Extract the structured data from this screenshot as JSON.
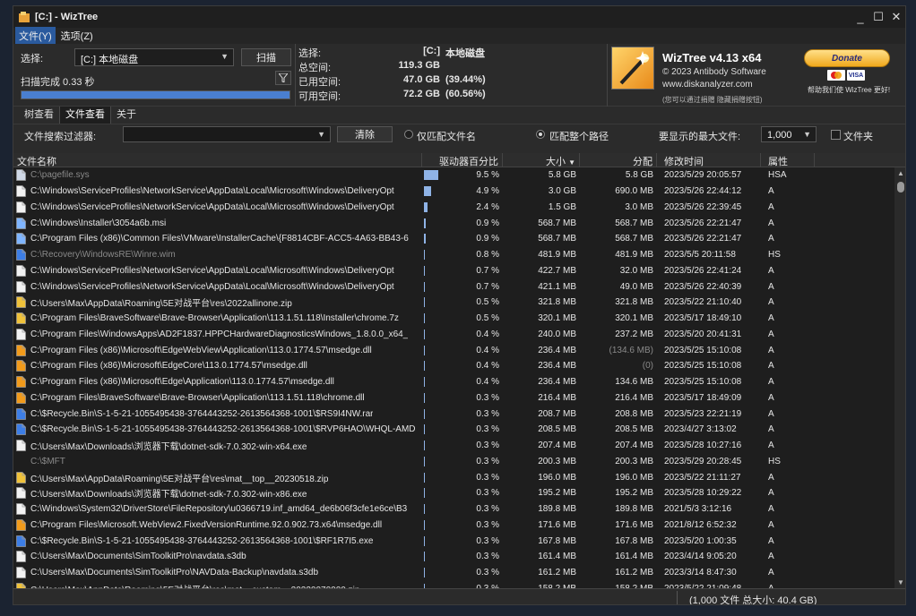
{
  "window": {
    "title": "[C:]  - WizTree",
    "minimize": "_",
    "maximize": "☐",
    "close": "✕"
  },
  "menu": [
    {
      "label": "文件(Y)",
      "active": true
    },
    {
      "label": "选项(Z)",
      "active": false
    }
  ],
  "top": {
    "select_label": "选择:",
    "drive_value": "[C:] 本地磁盘",
    "scan_button": "扫描",
    "scan_status": "扫描完成 0.33 秒",
    "progress": 1.0
  },
  "stats": {
    "select_k": "选择:",
    "select_v1": "[C:]",
    "select_v2": "本地磁盘",
    "total_k": "总空间:",
    "total_v": "119.3 GB",
    "used_k": "已用空间:",
    "used_v": "47.0 GB",
    "used_pct": "(39.44%)",
    "free_k": "可用空间:",
    "free_v": "72.2 GB",
    "free_pct": "(60.56%)"
  },
  "brand": {
    "name": "WizTree v4.13 x64",
    "copyright": "© 2023 Antibody Software",
    "url": "www.diskanalyzer.com",
    "hint": "(您可以通过捐赠 隐藏捐赠按钮)",
    "donate": "Donate",
    "card_visa": "VISA",
    "support": "帮助我们使 WizTree 更好!"
  },
  "tabs": [
    {
      "label": "树查看",
      "active": false
    },
    {
      "label": "文件查看",
      "active": true
    },
    {
      "label": "关于",
      "active": false
    }
  ],
  "filter": {
    "label": "文件搜索过滤器:",
    "value": "",
    "clear": "清除",
    "match_name": "仅匹配文件名",
    "match_path": "匹配整个路径",
    "max_label": "要显示的最大文件:",
    "max_value": "1,000",
    "folder": "文件夹"
  },
  "columns": {
    "name": "文件名称",
    "pct": "驱动器百分比",
    "size": "大小",
    "alloc": "分配",
    "date": "修改时间",
    "attr": "属性"
  },
  "icon_colors": {
    "file": "#f2f2f2",
    "sys": "#cfd8e6",
    "msi": "#7fb5ff",
    "zip": "#f0c23a",
    "edge": "#f29b1b",
    "blue": "#3d7ee6"
  },
  "rows": [
    {
      "icon": "sys",
      "name": "C:\\pagefile.sys",
      "pct": "9.5 %",
      "pct_v": 9.5,
      "size": "5.8 GB",
      "alloc": "5.8 GB",
      "date": "2023/5/29 20:05:57",
      "attr": "HSA",
      "dim": true
    },
    {
      "icon": "file",
      "name": "C:\\Windows\\ServiceProfiles\\NetworkService\\AppData\\Local\\Microsoft\\Windows\\DeliveryOpt",
      "pct": "4.9 %",
      "pct_v": 4.9,
      "size": "3.0 GB",
      "alloc": "690.0 MB",
      "date": "2023/5/26 22:44:12",
      "attr": "A"
    },
    {
      "icon": "file",
      "name": "C:\\Windows\\ServiceProfiles\\NetworkService\\AppData\\Local\\Microsoft\\Windows\\DeliveryOpt",
      "pct": "2.4 %",
      "pct_v": 2.4,
      "size": "1.5 GB",
      "alloc": "3.0 MB",
      "date": "2023/5/26 22:39:45",
      "attr": "A"
    },
    {
      "icon": "msi",
      "name": "C:\\Windows\\Installer\\3054a6b.msi",
      "pct": "0.9 %",
      "pct_v": 0.9,
      "size": "568.7 MB",
      "alloc": "568.7 MB",
      "date": "2023/5/26 22:21:47",
      "attr": "A"
    },
    {
      "icon": "msi",
      "name": "C:\\Program Files (x86)\\Common Files\\VMware\\InstallerCache\\{F8814CBF-ACC5-4A63-BB43-6",
      "pct": "0.9 %",
      "pct_v": 0.9,
      "size": "568.7 MB",
      "alloc": "568.7 MB",
      "date": "2023/5/26 22:21:47",
      "attr": "A"
    },
    {
      "icon": "blue",
      "name": "C:\\Recovery\\WindowsRE\\Winre.wim",
      "pct": "0.8 %",
      "pct_v": 0.8,
      "size": "481.9 MB",
      "alloc": "481.9 MB",
      "date": "2023/5/5 20:11:58",
      "attr": "HS",
      "dim": true
    },
    {
      "icon": "file",
      "name": "C:\\Windows\\ServiceProfiles\\NetworkService\\AppData\\Local\\Microsoft\\Windows\\DeliveryOpt",
      "pct": "0.7 %",
      "pct_v": 0.7,
      "size": "422.7 MB",
      "alloc": "32.0 MB",
      "date": "2023/5/26 22:41:24",
      "attr": "A"
    },
    {
      "icon": "file",
      "name": "C:\\Windows\\ServiceProfiles\\NetworkService\\AppData\\Local\\Microsoft\\Windows\\DeliveryOpt",
      "pct": "0.7 %",
      "pct_v": 0.7,
      "size": "421.1 MB",
      "alloc": "49.0 MB",
      "date": "2023/5/26 22:40:39",
      "attr": "A"
    },
    {
      "icon": "zip",
      "name": "C:\\Users\\Max\\AppData\\Roaming\\5E对战平台\\res\\2022allinone.zip",
      "pct": "0.5 %",
      "pct_v": 0.5,
      "size": "321.8 MB",
      "alloc": "321.8 MB",
      "date": "2023/5/22 21:10:40",
      "attr": "A"
    },
    {
      "icon": "zip",
      "name": "C:\\Program Files\\BraveSoftware\\Brave-Browser\\Application\\113.1.51.118\\Installer\\chrome.7z",
      "pct": "0.5 %",
      "pct_v": 0.5,
      "size": "320.1 MB",
      "alloc": "320.1 MB",
      "date": "2023/5/17 18:49:10",
      "attr": "A"
    },
    {
      "icon": "file",
      "name": "C:\\Program Files\\WindowsApps\\AD2F1837.HPPCHardwareDiagnosticsWindows_1.8.0.0_x64_",
      "pct": "0.4 %",
      "pct_v": 0.4,
      "size": "240.0 MB",
      "alloc": "237.2 MB",
      "date": "2023/5/20 20:41:31",
      "attr": "A"
    },
    {
      "icon": "edge",
      "name": "C:\\Program Files (x86)\\Microsoft\\EdgeWebView\\Application\\113.0.1774.57\\msedge.dll",
      "pct": "0.4 %",
      "pct_v": 0.4,
      "size": "236.4 MB",
      "alloc": "(134.6 MB)",
      "alloc_dim": true,
      "date": "2023/5/25 15:10:08",
      "attr": "A"
    },
    {
      "icon": "edge",
      "name": "C:\\Program Files (x86)\\Microsoft\\EdgeCore\\113.0.1774.57\\msedge.dll",
      "pct": "0.4 %",
      "pct_v": 0.4,
      "size": "236.4 MB",
      "alloc": "(0)",
      "alloc_dim": true,
      "date": "2023/5/25 15:10:08",
      "attr": "A"
    },
    {
      "icon": "edge",
      "name": "C:\\Program Files (x86)\\Microsoft\\Edge\\Application\\113.0.1774.57\\msedge.dll",
      "pct": "0.4 %",
      "pct_v": 0.4,
      "size": "236.4 MB",
      "alloc": "134.6 MB",
      "date": "2023/5/25 15:10:08",
      "attr": "A"
    },
    {
      "icon": "edge",
      "name": "C:\\Program Files\\BraveSoftware\\Brave-Browser\\Application\\113.1.51.118\\chrome.dll",
      "pct": "0.3 %",
      "pct_v": 0.3,
      "size": "216.4 MB",
      "alloc": "216.4 MB",
      "date": "2023/5/17 18:49:09",
      "attr": "A"
    },
    {
      "icon": "blue",
      "name": "C:\\$Recycle.Bin\\S-1-5-21-1055495438-3764443252-2613564368-1001\\$RS9I4NW.rar",
      "pct": "0.3 %",
      "pct_v": 0.3,
      "size": "208.7 MB",
      "alloc": "208.8 MB",
      "date": "2023/5/23 22:21:19",
      "attr": "A"
    },
    {
      "icon": "blue",
      "name": "C:\\$Recycle.Bin\\S-1-5-21-1055495438-3764443252-2613564368-1001\\$RVP6HAO\\WHQL-AMD",
      "pct": "0.3 %",
      "pct_v": 0.3,
      "size": "208.5 MB",
      "alloc": "208.5 MB",
      "date": "2023/4/27 3:13:02",
      "attr": "A"
    },
    {
      "icon": "file",
      "name": "C:\\Users\\Max\\Downloads\\浏览器下载\\dotnet-sdk-7.0.302-win-x64.exe",
      "pct": "0.3 %",
      "pct_v": 0.3,
      "size": "207.4 MB",
      "alloc": "207.4 MB",
      "date": "2023/5/28 10:27:16",
      "attr": "A"
    },
    {
      "icon": "none",
      "name": "C:\\$MFT",
      "pct": "0.3 %",
      "pct_v": 0.3,
      "size": "200.3 MB",
      "alloc": "200.3 MB",
      "date": "2023/5/29 20:28:45",
      "attr": "HS",
      "dim": true
    },
    {
      "icon": "zip",
      "name": "C:\\Users\\Max\\AppData\\Roaming\\5E对战平台\\res\\mat__top__20230518.zip",
      "pct": "0.3 %",
      "pct_v": 0.3,
      "size": "196.0 MB",
      "alloc": "196.0 MB",
      "date": "2023/5/22 21:11:27",
      "attr": "A"
    },
    {
      "icon": "file",
      "name": "C:\\Users\\Max\\Downloads\\浏览器下载\\dotnet-sdk-7.0.302-win-x86.exe",
      "pct": "0.3 %",
      "pct_v": 0.3,
      "size": "195.2 MB",
      "alloc": "195.2 MB",
      "date": "2023/5/28 10:29:22",
      "attr": "A"
    },
    {
      "icon": "file",
      "name": "C:\\Windows\\System32\\DriverStore\\FileRepository\\u0366719.inf_amd64_de6b06f3cfe1e6ce\\B3",
      "pct": "0.3 %",
      "pct_v": 0.3,
      "size": "189.8 MB",
      "alloc": "189.8 MB",
      "date": "2021/5/3 3:12:16",
      "attr": "A"
    },
    {
      "icon": "edge",
      "name": "C:\\Program Files\\Microsoft.WebView2.FixedVersionRuntime.92.0.902.73.x64\\msedge.dll",
      "pct": "0.3 %",
      "pct_v": 0.3,
      "size": "171.6 MB",
      "alloc": "171.6 MB",
      "date": "2021/8/12 6:52:32",
      "attr": "A"
    },
    {
      "icon": "blue",
      "name": "C:\\$Recycle.Bin\\S-1-5-21-1055495438-3764443252-2613564368-1001\\$RF1R7I5.exe",
      "pct": "0.3 %",
      "pct_v": 0.3,
      "size": "167.8 MB",
      "alloc": "167.8 MB",
      "date": "2023/5/20 1:00:35",
      "attr": "A"
    },
    {
      "icon": "file",
      "name": "C:\\Users\\Max\\Documents\\SimToolkitPro\\navdata.s3db",
      "pct": "0.3 %",
      "pct_v": 0.3,
      "size": "161.4 MB",
      "alloc": "161.4 MB",
      "date": "2023/4/14 9:05:20",
      "attr": "A"
    },
    {
      "icon": "file",
      "name": "C:\\Users\\Max\\Documents\\SimToolkitPro\\NAVData-Backup\\navdata.s3db",
      "pct": "0.3 %",
      "pct_v": 0.3,
      "size": "161.2 MB",
      "alloc": "161.2 MB",
      "date": "2023/3/14 8:47:30",
      "attr": "A"
    },
    {
      "icon": "zip",
      "name": "C:\\Users\\Max\\AppData\\Roaming\\5E对战平台\\res\\mat__custom__20220070000.zip",
      "pct": "0.3 %",
      "pct_v": 0.3,
      "size": "158.2 MB",
      "alloc": "158.2 MB",
      "date": "2023/5/22 21:09:48",
      "attr": "A"
    }
  ],
  "status": "(1,000 文件  总大小: 40.4 GB)"
}
